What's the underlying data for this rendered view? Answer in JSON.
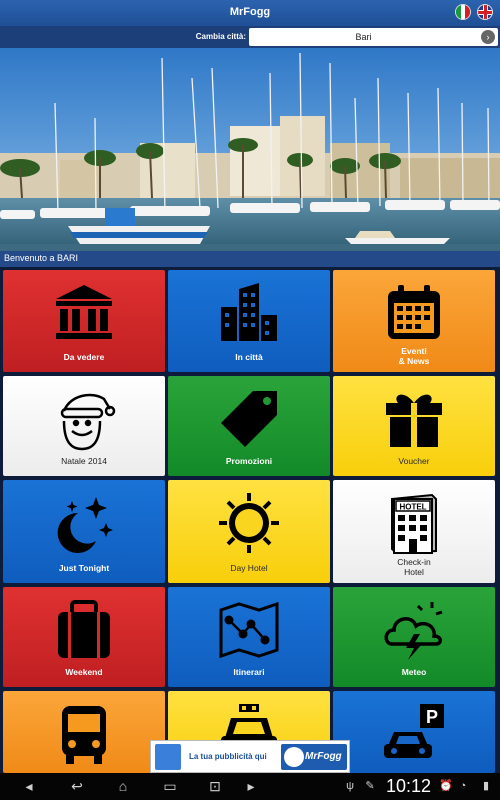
{
  "app": {
    "title": "MrFogg"
  },
  "city": {
    "change_label": "Cambia città:",
    "selected": "Bari"
  },
  "welcome": "Benvenuto a BARI",
  "tiles": [
    {
      "label": "Da vedere",
      "color": "#d42a2a",
      "icon": "museum-icon"
    },
    {
      "label": "In città",
      "color": "#1766c8",
      "icon": "buildings-icon"
    },
    {
      "label": "Eventi\n& News",
      "color": "#f5991f",
      "icon": "calendar-icon"
    },
    {
      "label": "Natale 2014",
      "color": "#ffffff",
      "icon": "santa-icon"
    },
    {
      "label": "Promozioni",
      "color": "#1f9a33",
      "icon": "tag-icon"
    },
    {
      "label": "Voucher",
      "color": "#fad520",
      "icon": "gift-icon"
    },
    {
      "label": "Just Tonight",
      "color": "#1766c8",
      "icon": "moon-stars-icon"
    },
    {
      "label": "Day Hotel",
      "color": "#fad520",
      "icon": "sun-icon"
    },
    {
      "label": "Check-in\nHotel",
      "color": "#ffffff",
      "icon": "hotel-icon"
    },
    {
      "label": "Weekend",
      "color": "#d42a2a",
      "icon": "suitcase-icon"
    },
    {
      "label": "Itinerari",
      "color": "#1766c8",
      "icon": "map-icon"
    },
    {
      "label": "Meteo",
      "color": "#1f9a33",
      "icon": "weather-icon"
    },
    {
      "label": "",
      "color": "#f5991f",
      "icon": "bus-icon"
    },
    {
      "label": "",
      "color": "#fad520",
      "icon": "taxi-icon"
    },
    {
      "label": "",
      "color": "#1766c8",
      "icon": "parking-icon"
    }
  ],
  "ad": {
    "text": "La tua pubblicità qui",
    "brand": "MrFogg"
  },
  "statusbar": {
    "time": "10:12"
  }
}
